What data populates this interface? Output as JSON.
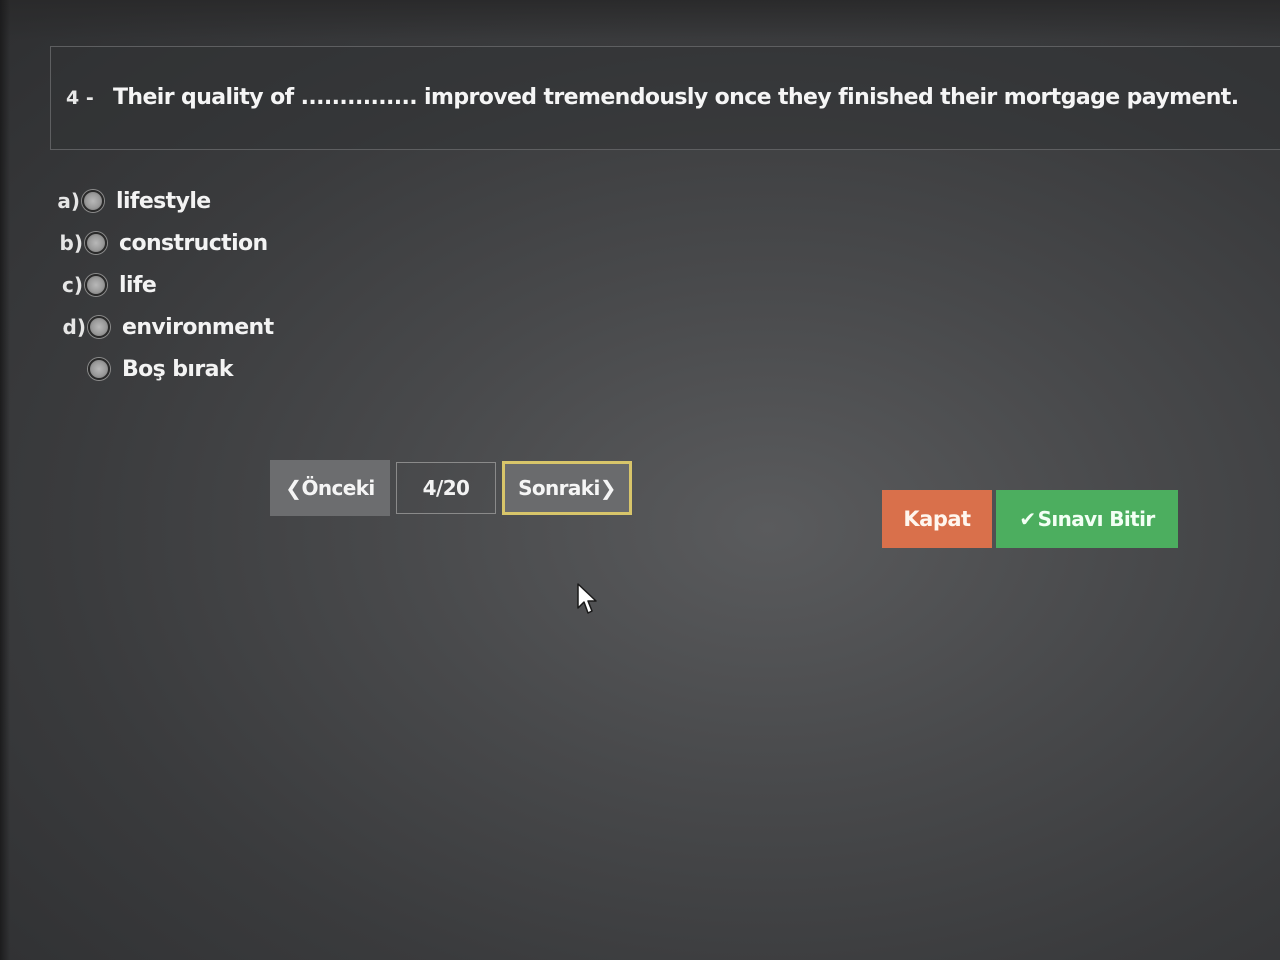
{
  "question": {
    "number": "4 -",
    "text": "Their quality of ............... improved tremendously once they finished their mortgage payment."
  },
  "options": [
    {
      "letter": "a)",
      "label": "lifestyle"
    },
    {
      "letter": "b)",
      "label": "construction"
    },
    {
      "letter": "c)",
      "label": "life"
    },
    {
      "letter": "d)",
      "label": "environment"
    },
    {
      "letter": "",
      "label": "Boş bırak"
    }
  ],
  "navigation": {
    "prev_label": "Önceki",
    "page_indicator": "4/20",
    "next_label": "Sonraki"
  },
  "actions": {
    "close_label": "Kapat",
    "finish_label": "Sınavı Bitir"
  },
  "colors": {
    "close_button": "#d9704b",
    "finish_button": "#4cae5f",
    "next_focus_border": "#d8c56a",
    "prev_button": "#6c6d6f"
  },
  "icons": {
    "prev": "chevron-left-icon",
    "next": "chevron-right-icon",
    "finish": "check-icon",
    "pointer": "mouse-cursor-icon"
  }
}
